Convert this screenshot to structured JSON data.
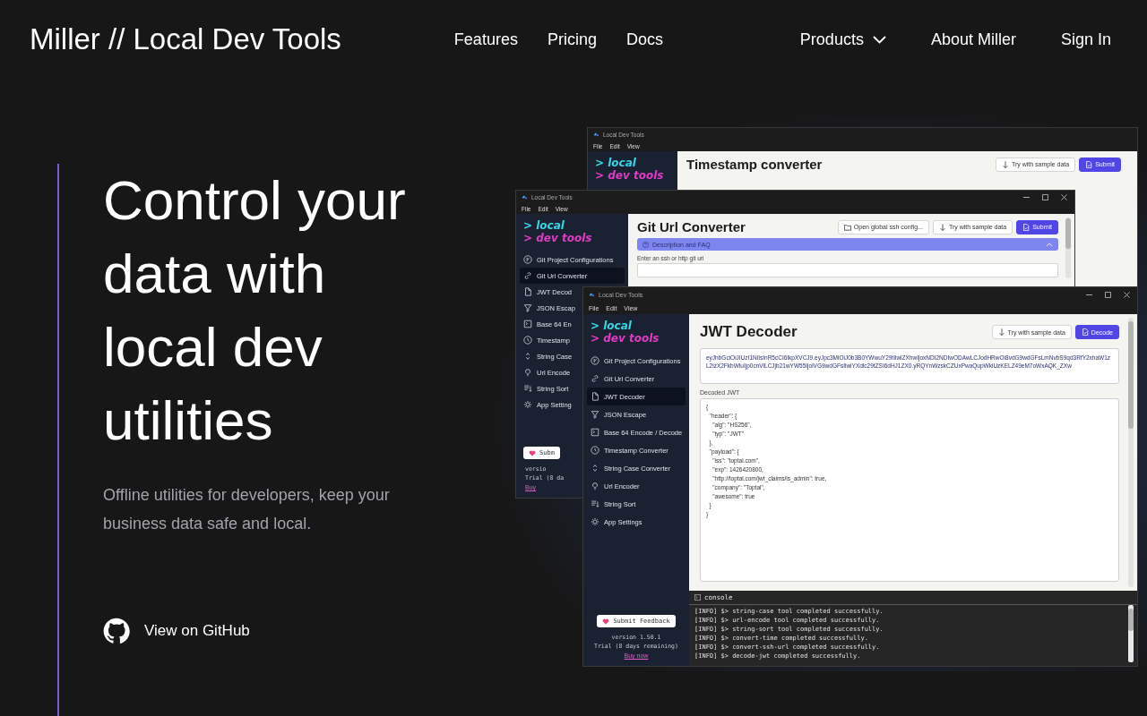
{
  "header": {
    "brand": "Miller // Local Dev Tools",
    "nav_main": [
      {
        "label": "Features",
        "kind": "link"
      },
      {
        "label": "Pricing",
        "kind": "link"
      },
      {
        "label": "Docs",
        "kind": "link"
      }
    ],
    "nav_right": [
      {
        "label": "Products",
        "kind": "dropdown"
      },
      {
        "label": "About Miller",
        "kind": "link"
      },
      {
        "label": "Sign In",
        "kind": "link"
      }
    ]
  },
  "hero": {
    "heading": "Control your data with local dev utilities",
    "subtitle": "Offline utilities for developers, keep your business data safe and local.",
    "github_link": "View on GitHub"
  },
  "windows": [
    {
      "kind": "back",
      "title": "Local Dev Tools",
      "menu": [
        "File",
        "Edit",
        "View"
      ],
      "logo": [
        "> local",
        "> dev tools"
      ],
      "heading": "Timestamp converter",
      "actions": [
        {
          "label": "Try with sample data",
          "kind": "sample"
        },
        {
          "label": "Submit",
          "kind": "primary"
        }
      ]
    },
    {
      "kind": "middle",
      "title": "Local Dev Tools",
      "menu": [
        "File",
        "Edit",
        "View"
      ],
      "logo": [
        "> local",
        "> dev tools"
      ],
      "heading": "Git Url Converter",
      "actions": [
        {
          "label": "Open global ssh config...",
          "kind": "folder"
        },
        {
          "label": "Try with sample data",
          "kind": "sample"
        },
        {
          "label": "Submit",
          "kind": "primary"
        }
      ],
      "faq": {
        "label": "Description and FAQ",
        "expanded": true
      },
      "input_label": "Enter an ssh or http git url",
      "sidebar": [
        {
          "label": "Git Project Configurations",
          "selected": false
        },
        {
          "label": "Git Url Converter",
          "selected": true
        },
        {
          "label": "JWT Decod",
          "selected": false
        },
        {
          "label": "JSON Escap",
          "selected": false
        },
        {
          "label": "Base 64 En",
          "selected": false
        },
        {
          "label": "Timestamp",
          "selected": false
        },
        {
          "label": "String Case",
          "selected": false
        },
        {
          "label": "Url Encode",
          "selected": false
        },
        {
          "label": "String Sort",
          "selected": false
        },
        {
          "label": "App Setting",
          "selected": false
        }
      ],
      "feedback": "Subm",
      "version": "versio",
      "trial": "Trial (8 da",
      "buy": "Buy"
    },
    {
      "kind": "front",
      "title": "Local Dev Tools",
      "menu": [
        "File",
        "Edit",
        "View"
      ],
      "logo": [
        "> local",
        "> dev tools"
      ],
      "heading": "JWT Decoder",
      "actions": [
        {
          "label": "Try with sample data",
          "kind": "sample"
        },
        {
          "label": "Decode",
          "kind": "primary"
        }
      ],
      "token": "eyJhbGciOiJIUzI1NiIsInR5cCI6IkpXVCJ9.eyJpc3MiOiJ0b3B0YWwuY29tIiwiZXhwIjoxNDI2NDIwODAwLCJodHRwOi8vdG9wdGFsLmNvbS9qd3RfY2xhaW1zL2lzX2FkbWluIjp0cnVlLCJjb21wYW55IjoiVG9wdGFsIiwiYXdlc29tZSI6dHJ1ZX0.yRQYnWzskCZUxPwaQupWkiUzKELZ49eM7oWxAQK_ZXw",
      "output_label": "Decoded JWT",
      "output": "{\n  \"header\": {\n    \"alg\": \"HS256\",\n    \"typ\": \"JWT\"\n  },\n  \"payload\": {\n    \"iss\": \"toptal.com\",\n    \"exp\": 1426420800,\n    \"http://toptal.com/jwt_claims/is_admin\": true,\n    \"company\": \"Toptal\",\n    \"awesome\": true\n  }\n}",
      "console": {
        "title": "console",
        "lines": [
          "[INFO] $> string-case tool completed successfully.",
          "[INFO] $> url-encode tool completed successfully.",
          "[INFO] $> string-sort tool completed successfully.",
          "[INFO] $> convert-time completed successfully.",
          "[INFO] $> convert-ssh-url completed successfully.",
          "[INFO] $> decode-jwt completed successfully."
        ]
      },
      "sidebar": [
        {
          "label": "Git Project Configurations",
          "selected": false
        },
        {
          "label": "Git Url Converter",
          "selected": false
        },
        {
          "label": "JWT Decoder",
          "selected": true
        },
        {
          "label": "JSON Escape",
          "selected": false
        },
        {
          "label": "Base 64 Encode / Decode",
          "selected": false
        },
        {
          "label": "Timestamp Converter",
          "selected": false
        },
        {
          "label": "String Case Converter",
          "selected": false
        },
        {
          "label": "Url Encoder",
          "selected": false
        },
        {
          "label": "String Sort",
          "selected": false
        },
        {
          "label": "App Settings",
          "selected": false
        }
      ],
      "feedback": "Submit Feedback",
      "version": "version 1.50.1",
      "trial": "Trial (8 days remaining)",
      "buy": "Buy now"
    }
  ]
}
